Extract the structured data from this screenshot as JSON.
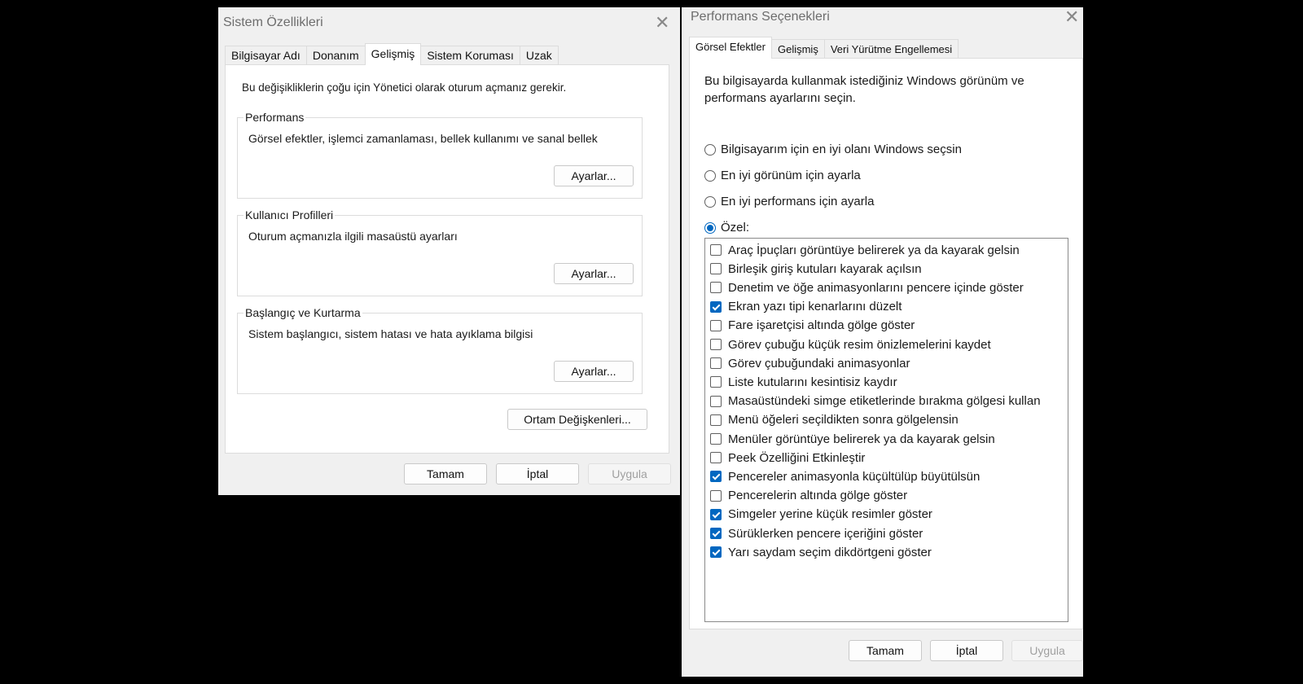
{
  "sys": {
    "title": "Sistem Özellikleri",
    "tabs": [
      "Bilgisayar Adı",
      "Donanım",
      "Gelişmiş",
      "Sistem Koruması",
      "Uzak"
    ],
    "notice": "Bu değişikliklerin çoğu için Yönetici olarak oturum açmanız gerekir.",
    "groups": [
      {
        "label": "Performans",
        "text": "Görsel efektler, işlemci zamanlaması, bellek kullanımı ve sanal bellek",
        "button": "Ayarlar..."
      },
      {
        "label": "Kullanıcı Profilleri",
        "text": "Oturum açmanızla ilgili masaüstü ayarları",
        "button": "Ayarlar..."
      },
      {
        "label": "Başlangıç ve Kurtarma",
        "text": "Sistem başlangıcı, sistem hatası ve hata ayıklama bilgisi",
        "button": "Ayarlar..."
      }
    ],
    "env_button": "Ortam Değişkenleri...",
    "ok": "Tamam",
    "cancel": "İptal",
    "apply": "Uygula"
  },
  "perf": {
    "title": "Performans Seçenekleri",
    "tabs": [
      "Görsel Efektler",
      "Gelişmiş",
      "Veri Yürütme Engellemesi"
    ],
    "intro": "Bu bilgisayarda kullanmak istediğiniz Windows görünüm ve performans ayarlarını seçin.",
    "radios": [
      {
        "label": "Bilgisayarım için en iyi olanı Windows seçsin",
        "checked": false
      },
      {
        "label": "En iyi görünüm için ayarla",
        "checked": false
      },
      {
        "label": "En iyi performans için ayarla",
        "checked": false
      },
      {
        "label": "Özel:",
        "checked": true
      }
    ],
    "options": [
      {
        "label": "Araç İpuçları görüntüye belirerek ya da kayarak gelsin",
        "checked": false
      },
      {
        "label": "Birleşik giriş kutuları kayarak açılsın",
        "checked": false
      },
      {
        "label": "Denetim ve öğe animasyonlarını pencere içinde göster",
        "checked": false
      },
      {
        "label": "Ekran yazı tipi kenarlarını düzelt",
        "checked": true
      },
      {
        "label": "Fare işaretçisi altında gölge göster",
        "checked": false
      },
      {
        "label": "Görev çubuğu küçük resim önizlemelerini kaydet",
        "checked": false
      },
      {
        "label": "Görev çubuğundaki animasyonlar",
        "checked": false
      },
      {
        "label": "Liste kutularını kesintisiz kaydır",
        "checked": false
      },
      {
        "label": "Masaüstündeki simge etiketlerinde bırakma gölgesi kullan",
        "checked": false
      },
      {
        "label": "Menü öğeleri seçildikten sonra gölgelensin",
        "checked": false
      },
      {
        "label": "Menüler görüntüye belirerek ya da kayarak gelsin",
        "checked": false
      },
      {
        "label": "Peek Özelliğini Etkinleştir",
        "checked": false
      },
      {
        "label": "Pencereler animasyonla küçültülüp büyütülsün",
        "checked": true
      },
      {
        "label": "Pencerelerin altında gölge göster",
        "checked": false
      },
      {
        "label": "Simgeler yerine küçük resimler göster",
        "checked": true
      },
      {
        "label": "Sürüklerken pencere içeriğini göster",
        "checked": true
      },
      {
        "label": "Yarı saydam seçim dikdörtgeni göster",
        "checked": true
      }
    ],
    "ok": "Tamam",
    "cancel": "İptal",
    "apply": "Uygula"
  },
  "colors": {
    "accent": "#0067c0"
  },
  "icons": {
    "close": "close-icon",
    "checkbox": "checkbox-icon",
    "radio": "radio-icon"
  }
}
